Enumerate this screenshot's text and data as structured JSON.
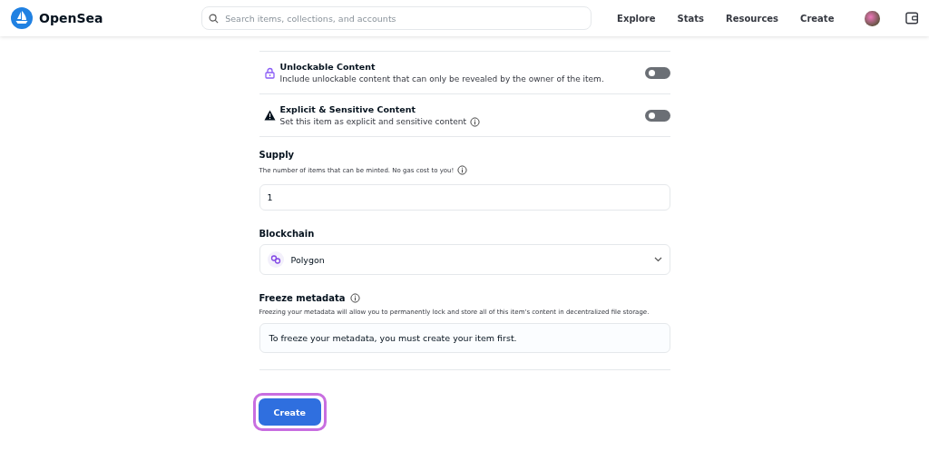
{
  "header": {
    "logo": "OpenSea",
    "search": {
      "placeholder": "Search items, collections, and accounts"
    },
    "nav": [
      "Explore",
      "Stats",
      "Resources",
      "Create"
    ]
  },
  "toggles": [
    {
      "kind": "lock",
      "title": "Unlockable Content",
      "description": "Include unlockable content that can only be revealed by the owner of the item.",
      "info": false,
      "on": false
    },
    {
      "kind": "warning",
      "title": "Explicit & Sensitive Content",
      "description": "Set this item as explicit and sensitive content",
      "info": true,
      "on": false
    }
  ],
  "supply": {
    "label": "Supply",
    "hint": "The number of items that can be minted. No gas cost to you!",
    "value": "1"
  },
  "blockchain": {
    "label": "Blockchain",
    "value": "Polygon"
  },
  "freeze": {
    "label": "Freeze metadata",
    "hint": "Freezing your metadata will allow you to permanently lock and store all of this item's content in decentralized file storage.",
    "notice": "To freeze your metadata, you must create your item first."
  },
  "submit": {
    "label": "Create",
    "highlighted": true
  }
}
